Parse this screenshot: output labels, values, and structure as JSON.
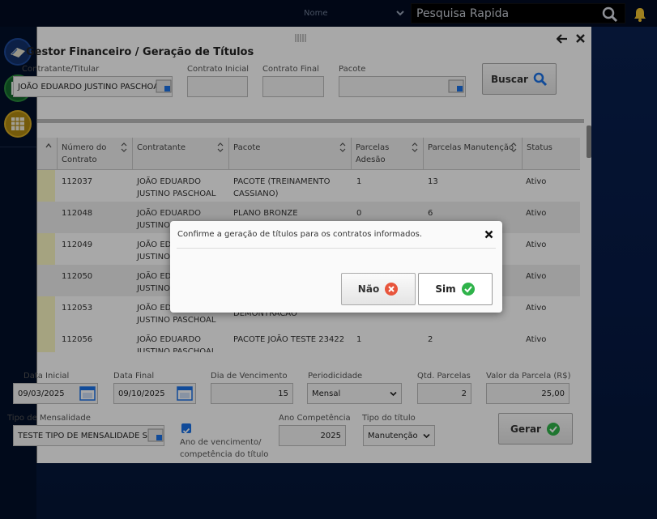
{
  "topbar": {
    "name_label": "Nome",
    "search_placeholder": "Pesquisa Rapida"
  },
  "window": {
    "title": "Gestor Financeiro / Geração de Títulos"
  },
  "filters": {
    "contratante_label": "Contratante/Titular",
    "contratante_value": "JOÃO EDUARDO JUSTINO PASCHOAL",
    "contrato_inicial_label": "Contrato Inicial",
    "contrato_final_label": "Contrato Final",
    "pacote_label": "Pacote",
    "buscar_label": "Buscar"
  },
  "grid": {
    "columns": [
      "Número do Contrato",
      "Contratante",
      "Pacote",
      "Parcelas Adesão",
      "Parcelas Manutenção",
      "Status"
    ],
    "rows": [
      {
        "numero": "112037",
        "contratante": "JOÃO EDUARDO JUSTINO PASCHOAL",
        "pacote": "PACOTE (TREINAMENTO CASSIANO)",
        "adesao": "1",
        "manutencao": "13",
        "status": "Ativo"
      },
      {
        "numero": "112048",
        "contratante": "JOÃO EDUARDO JUSTINO PASCHOAL",
        "pacote": "PLANO BRONZE",
        "adesao": "0",
        "manutencao": "6",
        "status": "Ativo"
      },
      {
        "numero": "112049",
        "contratante": "JOÃO EDUARDO JUSTINO PASCHOAL",
        "pacote": "",
        "adesao": "",
        "manutencao": "",
        "status": "Ativo"
      },
      {
        "numero": "112050",
        "contratante": "JOÃO EDUARDO JUSTINO PASCHOAL",
        "pacote": "",
        "adesao": "",
        "manutencao": "",
        "status": "Ativo"
      },
      {
        "numero": "112053",
        "contratante": "JOÃO EDUARDO JUSTINO PASCHOAL",
        "pacote": "DEMONTRACAO",
        "adesao": "",
        "manutencao": "",
        "status": "Ativo"
      },
      {
        "numero": "112056",
        "contratante": "JOÃO EDUARDO JUSTINO PASCHOAL",
        "pacote": "PACOTE JOÃO TESTE 23422",
        "adesao": "1",
        "manutencao": "2",
        "status": "Ativo"
      }
    ]
  },
  "params": {
    "data_inicial_label": "Data Inicial",
    "data_inicial_value": "09/03/2025",
    "data_final_label": "Data Final",
    "data_final_value": "09/10/2025",
    "dia_vencimento_label": "Dia de Vencimento",
    "dia_vencimento_value": "15",
    "periodicidade_label": "Periodicidade",
    "periodicidade_value": "Mensal",
    "qtd_parcelas_label": "Qtd. Parcelas",
    "qtd_parcelas_value": "2",
    "valor_parcela_label": "Valor da Parcela (R$)",
    "valor_parcela_value": "25,00",
    "tipo_mensalidade_label": "Tipo de Mensalidade",
    "tipo_mensalidade_value": "TESTE TIPO DE MENSALIDADE SEM",
    "ano_checkbox_label": "Ano de vencimento/ competência do título",
    "ano_competencia_label": "Ano Competência",
    "ano_competencia_value": "2025",
    "tipo_titulo_label": "Tipo do título",
    "tipo_titulo_value": "Manutenção",
    "gerar_label": "Gerar"
  },
  "modal": {
    "message": "Confirme a geração de títulos para os contratos informados.",
    "no_label": "Não",
    "yes_label": "Sim"
  },
  "colors": {
    "accent_blue": "#1a73e8",
    "success_green": "#2fb34a",
    "danger_red": "#e8553c",
    "bell_yellow": "#f2c230"
  }
}
